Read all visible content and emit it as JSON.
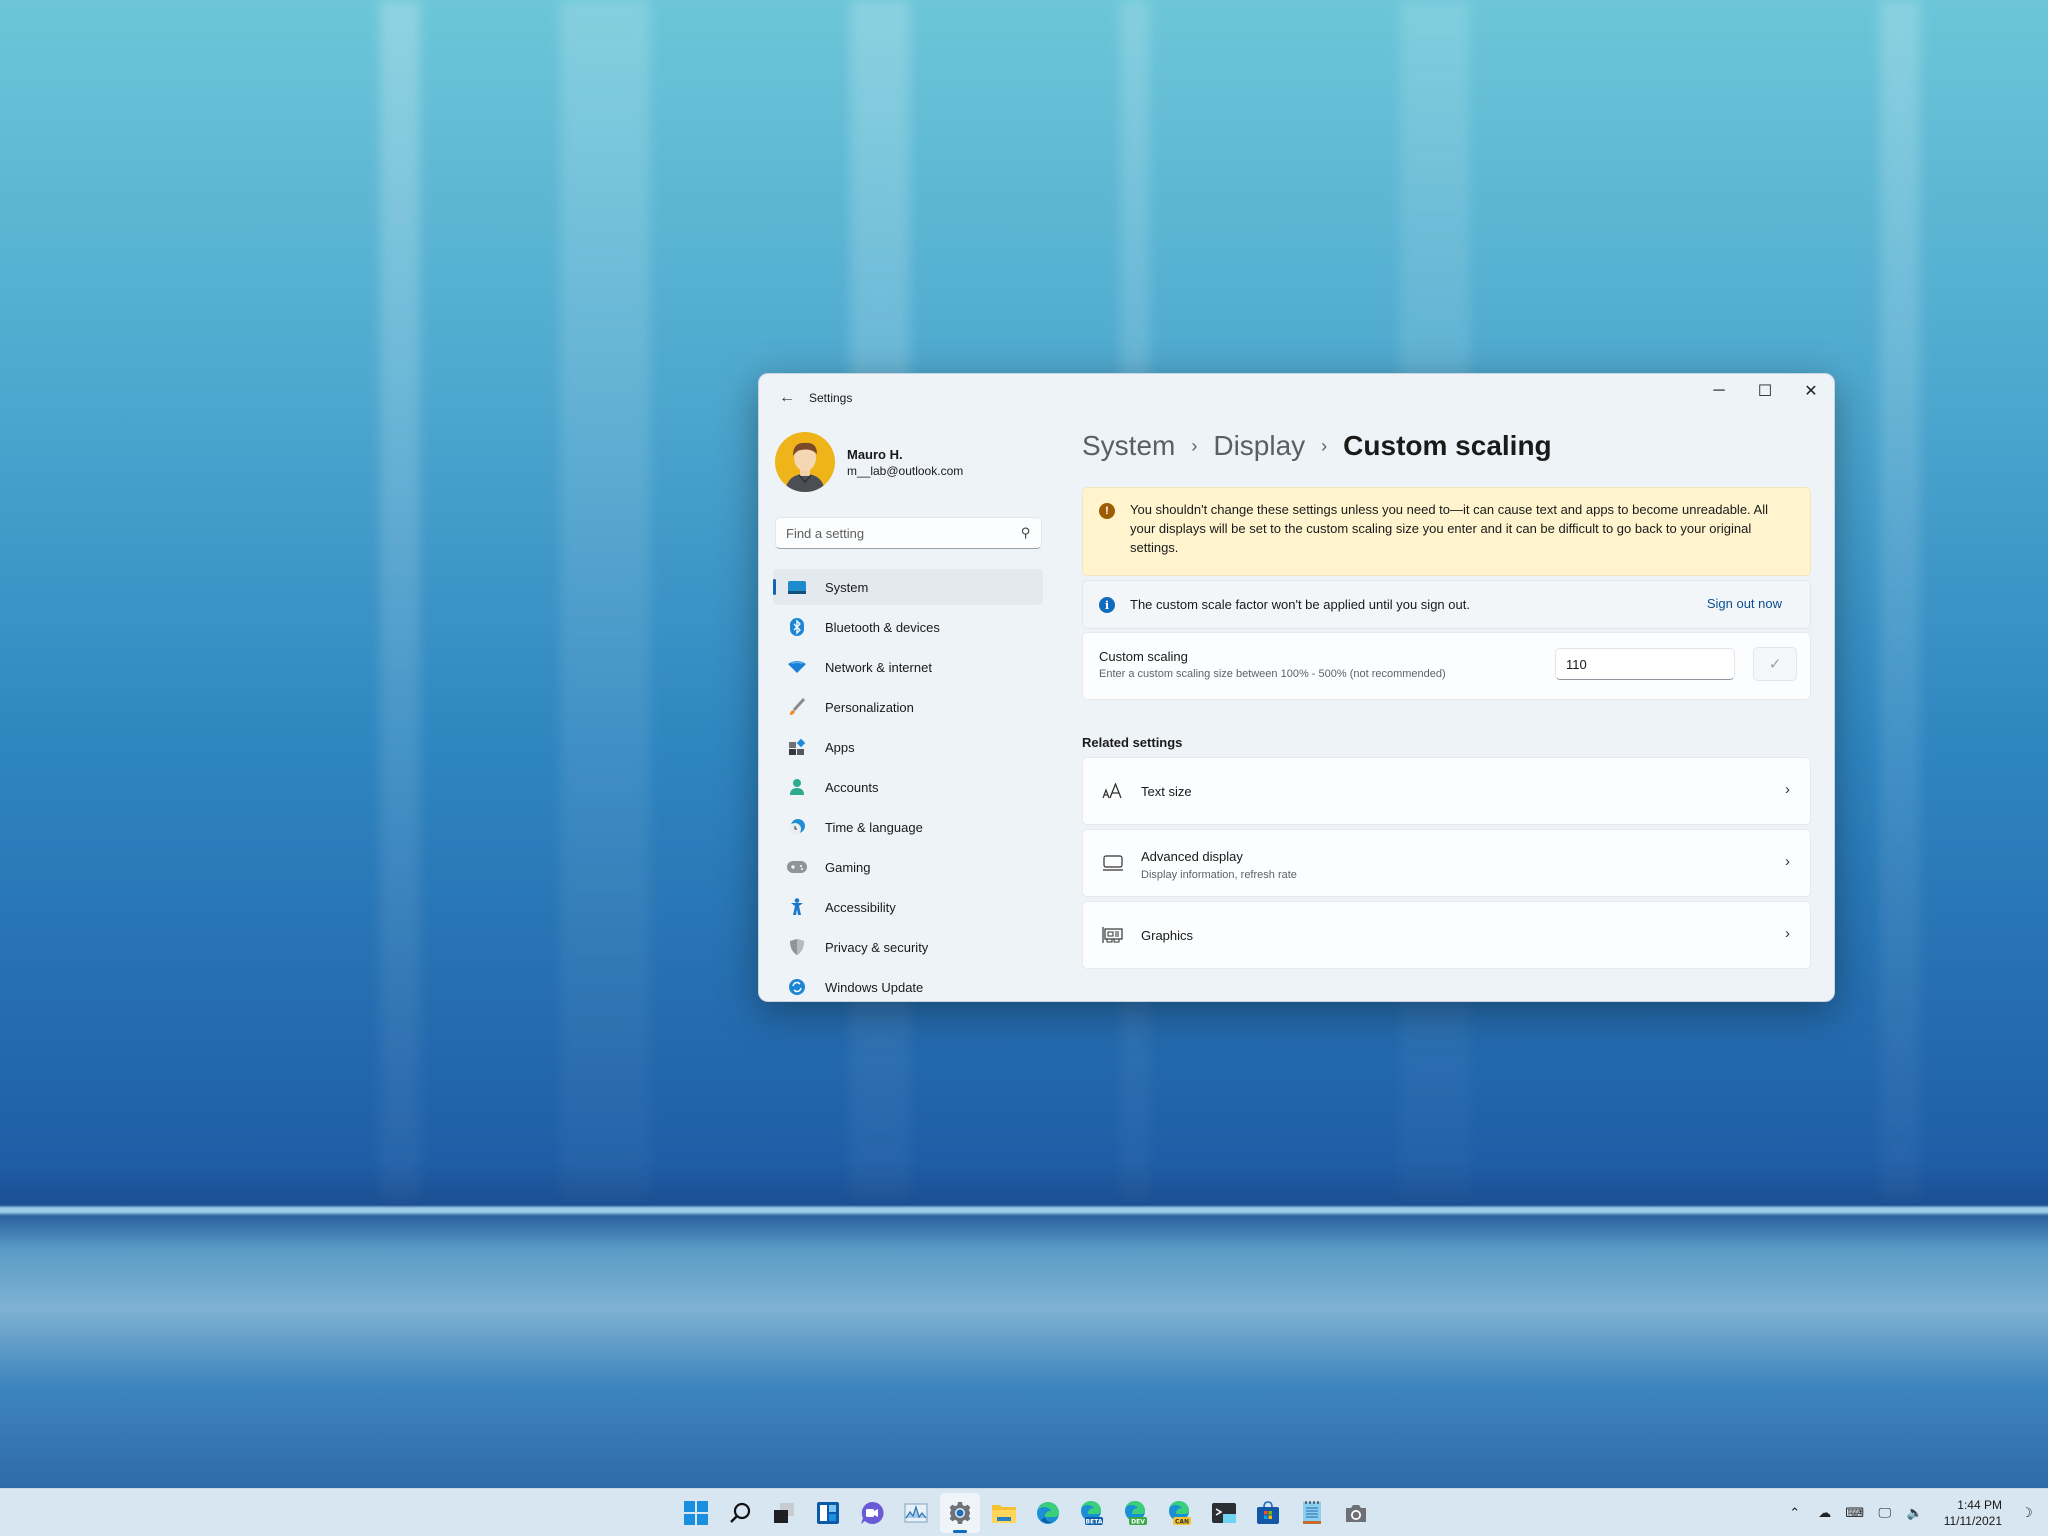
{
  "window": {
    "app_title": "Settings",
    "controls": {
      "minimize": "─",
      "maximize": "☐",
      "close": "✕"
    }
  },
  "profile": {
    "name": "Mauro H.",
    "email": "m__lab@outlook.com"
  },
  "search": {
    "placeholder": "Find a setting",
    "value": ""
  },
  "sidebar": {
    "items": [
      {
        "label": "System",
        "icon": "system-icon",
        "active": true
      },
      {
        "label": "Bluetooth & devices",
        "icon": "bluetooth-icon"
      },
      {
        "label": "Network & internet",
        "icon": "wifi-icon"
      },
      {
        "label": "Personalization",
        "icon": "brush-icon"
      },
      {
        "label": "Apps",
        "icon": "apps-icon"
      },
      {
        "label": "Accounts",
        "icon": "account-icon"
      },
      {
        "label": "Time & language",
        "icon": "clock-globe-icon"
      },
      {
        "label": "Gaming",
        "icon": "gamepad-icon"
      },
      {
        "label": "Accessibility",
        "icon": "accessibility-icon"
      },
      {
        "label": "Privacy & security",
        "icon": "shield-icon"
      },
      {
        "label": "Windows Update",
        "icon": "update-icon"
      }
    ]
  },
  "breadcrumb": {
    "items": [
      "System",
      "Display",
      "Custom scaling"
    ],
    "separator": "›"
  },
  "warning": {
    "text": "You shouldn't change these settings unless you need to—it can cause text and apps to become unreadable. All your displays will be set to the custom scaling size you enter and it can be difficult to go back to your original settings."
  },
  "info": {
    "text": "The custom scale factor won't be applied until you sign out.",
    "link": "Sign out now"
  },
  "custom_scaling": {
    "title": "Custom scaling",
    "description": "Enter a custom scaling size between 100% - 500% (not recommended)",
    "value": "110"
  },
  "related": {
    "heading": "Related settings",
    "items": [
      {
        "title": "Text size",
        "subtitle": "",
        "icon": "text-size-icon"
      },
      {
        "title": "Advanced display",
        "subtitle": "Display information, refresh rate",
        "icon": "monitor-icon"
      },
      {
        "title": "Graphics",
        "subtitle": "",
        "icon": "graphics-card-icon"
      }
    ]
  },
  "taskbar": {
    "apps": [
      "Start",
      "Search",
      "Task View",
      "Widgets",
      "Chat",
      "Performance Monitor",
      "Settings",
      "File Explorer",
      "Microsoft Edge",
      "Edge Beta",
      "Edge Dev",
      "Edge Canary",
      "Terminal",
      "Microsoft Store",
      "Notepad",
      "Camera"
    ],
    "badges": {
      "beta": "BETA",
      "dev": "DEV",
      "can": "CAN"
    },
    "time": "1:44 PM",
    "date": "11/11/2021"
  },
  "colors": {
    "accent": "#0f6cbd",
    "warning_bg": "#fff4ce",
    "warning_icon": "#9d5d00",
    "link": "#0a4f8f"
  }
}
